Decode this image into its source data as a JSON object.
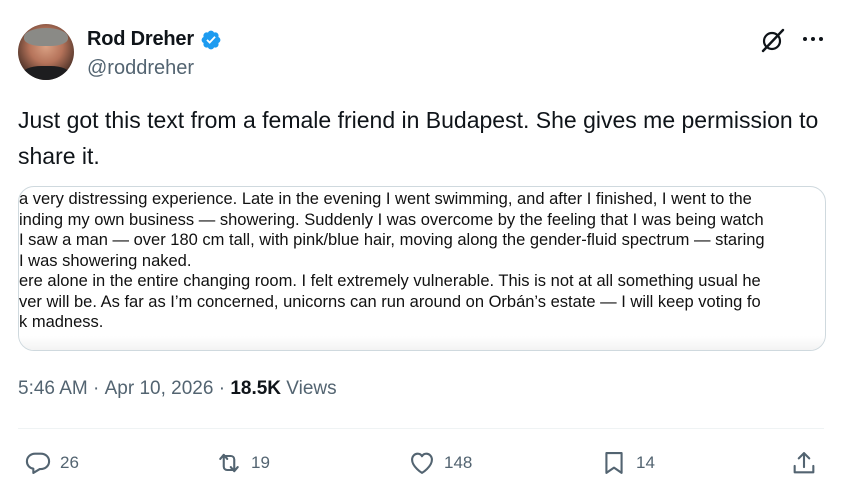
{
  "author": {
    "display_name": "Rod Dreher",
    "handle": "@roddreher",
    "verified_icon": "verified-badge-icon",
    "verified_color": "#1d9bf0"
  },
  "tweet": {
    "text": "Just got this text from a female friend in Budapest. She gives me permission to share it."
  },
  "image": {
    "lines": [
      "a very distressing experience. Late in the evening I went swimming, and after I finished, I went to the",
      "inding my own business — showering. Suddenly I was overcome by the feeling that I was being watch",
      "I saw a man — over 180 cm tall, with pink/blue hair, moving along the gender-fluid spectrum — staring",
      " I was showering naked.",
      "ere alone in the entire changing room. I felt extremely vulnerable. This is not at all something usual he",
      "ver will be. As far as I’m concerned, unicorns can run around on Orbán’s estate — I will keep voting fo",
      "k madness."
    ]
  },
  "meta": {
    "time": "5:46 AM",
    "separator": " · ",
    "date": "Apr 10, 2026",
    "views_count": "18.5K",
    "views_label": " Views"
  },
  "actions": {
    "replies": "26",
    "reposts": "19",
    "likes": "148",
    "bookmarks": "14"
  },
  "colors": {
    "text": "#0f1419",
    "secondary": "#536471",
    "border": "#cfd9de"
  }
}
